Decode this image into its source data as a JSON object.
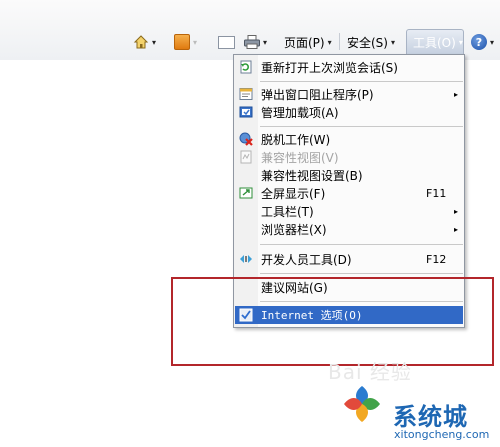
{
  "toolbar": {
    "page_label": "页面(P)",
    "safety_label": "安全(S)",
    "tools_label": "工具(O)",
    "arrow": "▾",
    "icons": [
      "home-icon",
      "rss-icon",
      "mail-icon",
      "print-icon",
      "help-icon"
    ],
    "help_glyph": "?"
  },
  "menu": {
    "items": [
      {
        "label": "重新打开上次浏览会话(S)",
        "icon": "reopen-session-icon"
      },
      {
        "label": "弹出窗口阻止程序(P)",
        "icon": "popup-blocker-icon",
        "submenu": "▸"
      },
      {
        "label": "管理加载项(A)",
        "icon": "addons-icon"
      },
      {
        "label": "脱机工作(W)",
        "icon": "work-offline-icon"
      },
      {
        "label": "兼容性视图(V)",
        "icon": "compat-view-icon",
        "disabled": true
      },
      {
        "label": "兼容性视图设置(B)"
      },
      {
        "label": "全屏显示(F)",
        "icon": "fullscreen-icon",
        "shortcut": "F11"
      },
      {
        "label": "工具栏(T)",
        "submenu": "▸"
      },
      {
        "label": "浏览器栏(X)",
        "submenu": "▸"
      },
      {
        "label": "开发人员工具(D)",
        "icon": "developer-tools-icon",
        "shortcut": "F12"
      },
      {
        "label": "建议网站(G)"
      },
      {
        "label": "Internet 选项(O)",
        "icon": "internet-options-icon",
        "selected": true
      }
    ]
  },
  "watermark": {
    "baidu": "Bai 经验",
    "brand": "系统城",
    "url": "xitongcheng.com"
  },
  "colors": {
    "selection": "#3169c6",
    "highlight_box": "#b3262b",
    "brand": "#1e67b3"
  }
}
